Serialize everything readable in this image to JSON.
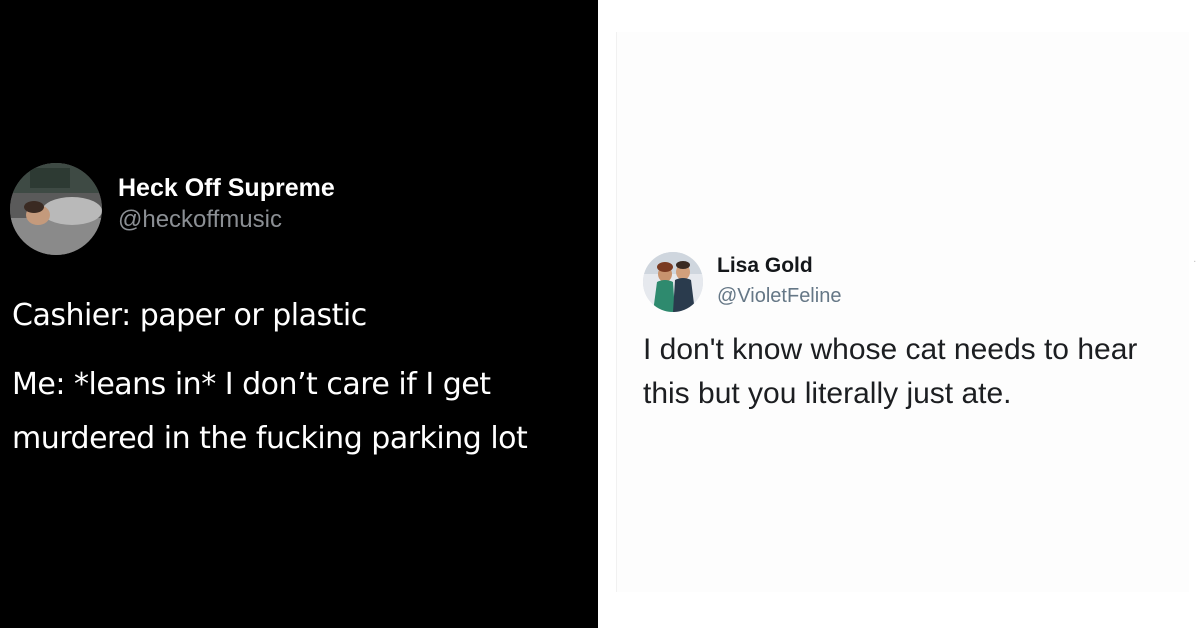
{
  "tweets": [
    {
      "display_name": "Heck Off Supreme",
      "handle": "@heckoffmusic",
      "lines": [
        "Cashier: paper or plastic",
        "Me: *leans in* I don’t care if I get",
        "murdered in the fucking parking lot"
      ],
      "theme": "dark"
    },
    {
      "display_name": "Lisa Gold",
      "handle": "@VioletFeline",
      "text": "I don't know whose cat needs to hear this but you literally just ate.",
      "menu_glyph": "˙",
      "theme": "light"
    }
  ],
  "colors": {
    "dark_bg": "#000000",
    "dark_text": "#ffffff",
    "dark_handle": "#8b8f94",
    "light_bg": "#ffffff",
    "light_text": "#1c1e21",
    "light_handle": "#657786"
  }
}
